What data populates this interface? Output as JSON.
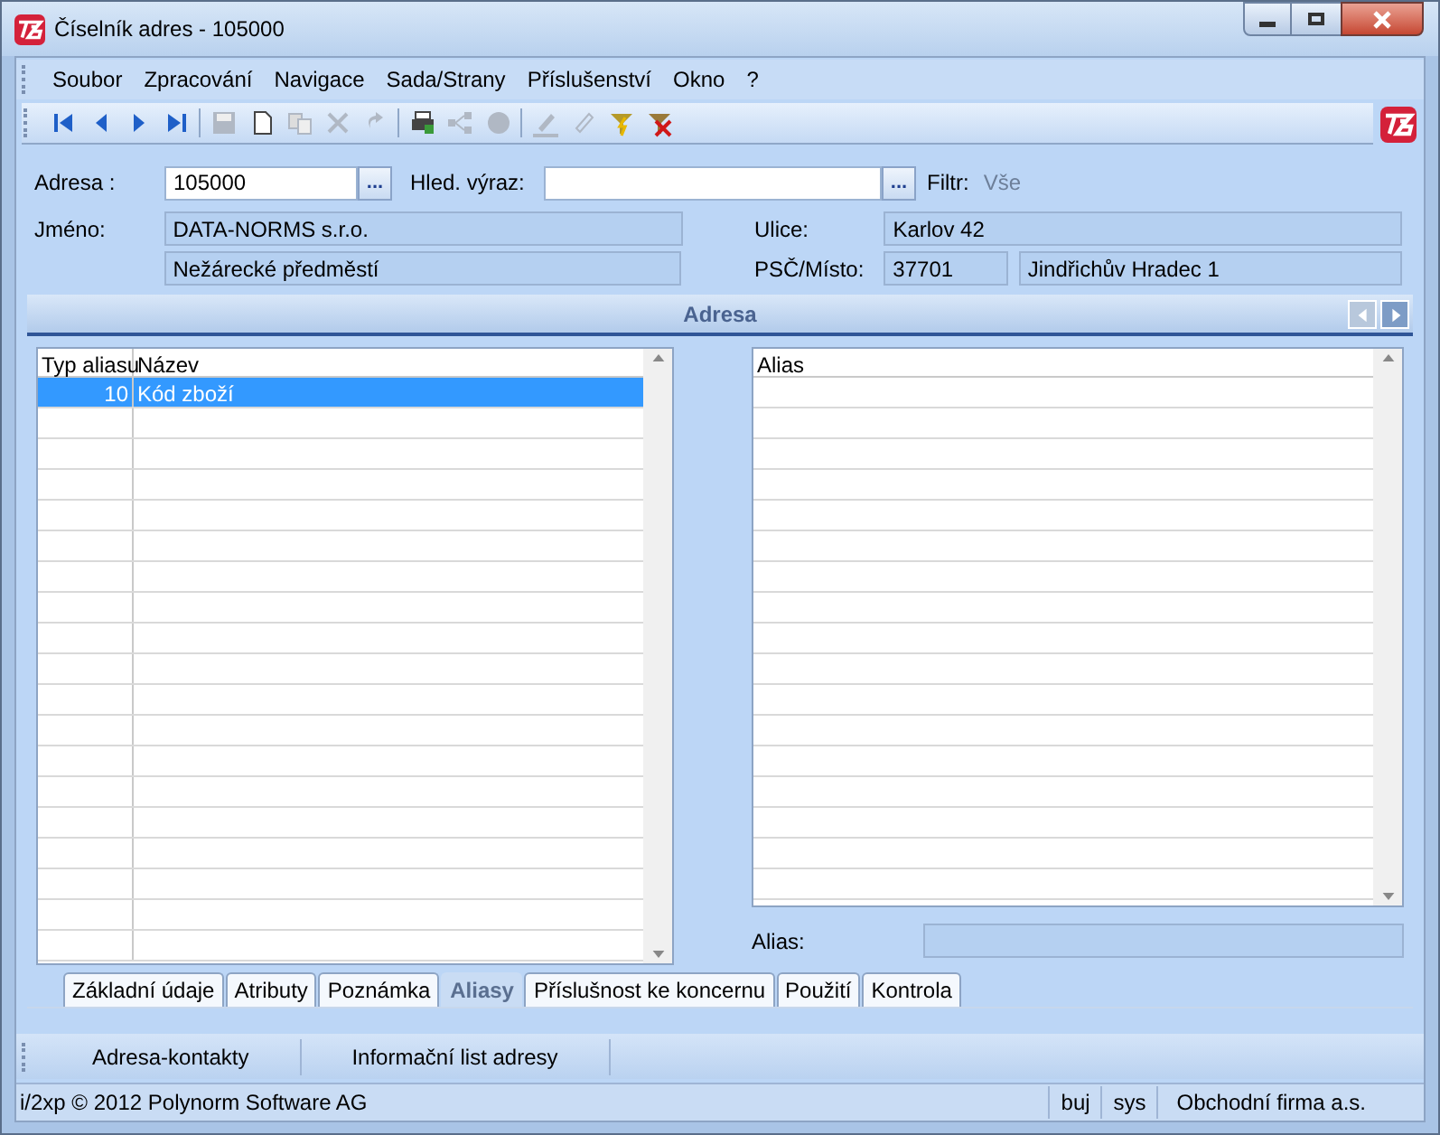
{
  "window": {
    "title": "Číselník adres - 105000"
  },
  "menu": [
    "Soubor",
    "Zpracování",
    "Navigace",
    "Sada/Strany",
    "Příslušenství",
    "Okno",
    "?"
  ],
  "toolbar": [
    {
      "disabled": false
    },
    {
      "disabled": false
    },
    {
      "disabled": false
    },
    {
      "disabled": false
    },
    {
      "disabled": true
    },
    {
      "disabled": false
    },
    {
      "disabled": true
    },
    {
      "disabled": true
    },
    {
      "disabled": true
    },
    {
      "disabled": false
    },
    {
      "disabled": true
    },
    {
      "disabled": true
    },
    {
      "disabled": true
    },
    {
      "disabled": true
    },
    {
      "disabled": false
    },
    {
      "disabled": false
    }
  ],
  "form": {
    "adresa_label": "Adresa :",
    "adresa": "105000",
    "hled_label": "Hled. výraz:",
    "filtr_label": "Filtr:",
    "filtr": "Vše",
    "jmeno_label": "Jméno:",
    "jmeno": "DATA-NORMS s.r.o.",
    "jmeno_2": "Nežárecké předměstí",
    "ulice_label": "Ulice:",
    "ulice": "Karlov 42",
    "psc_label": "PSČ/Místo:",
    "psc": "37701",
    "misto": "Jindřichův Hradec 1",
    "browse": "..."
  },
  "section": {
    "title": "Adresa"
  },
  "left_table": {
    "columns": [
      "Typ aliasu",
      "Název"
    ],
    "rows": [
      {
        "cells": [
          "10",
          "Kód zboží"
        ],
        "selected": true
      }
    ]
  },
  "right_table": {
    "columns": [
      "Alias"
    ]
  },
  "alias_field": {
    "label": "Alias:"
  },
  "tabs": [
    {
      "label": "Základní údaje",
      "selected": false
    },
    {
      "label": "Atributy",
      "selected": false
    },
    {
      "label": "Poznámka",
      "selected": false
    },
    {
      "label": "Aliasy",
      "selected": true
    },
    {
      "label": "Příslušnost ke koncernu",
      "selected": false
    },
    {
      "label": "Použití",
      "selected": false
    },
    {
      "label": "Kontrola",
      "selected": false
    }
  ],
  "bottom_buttons": [
    "Adresa-kontakty",
    "Informační list adresy"
  ],
  "status_bar": [
    "i/2xp © 2012 Polynorm Software AG",
    "buj",
    "sys",
    "Obchodní firma a.s."
  ]
}
